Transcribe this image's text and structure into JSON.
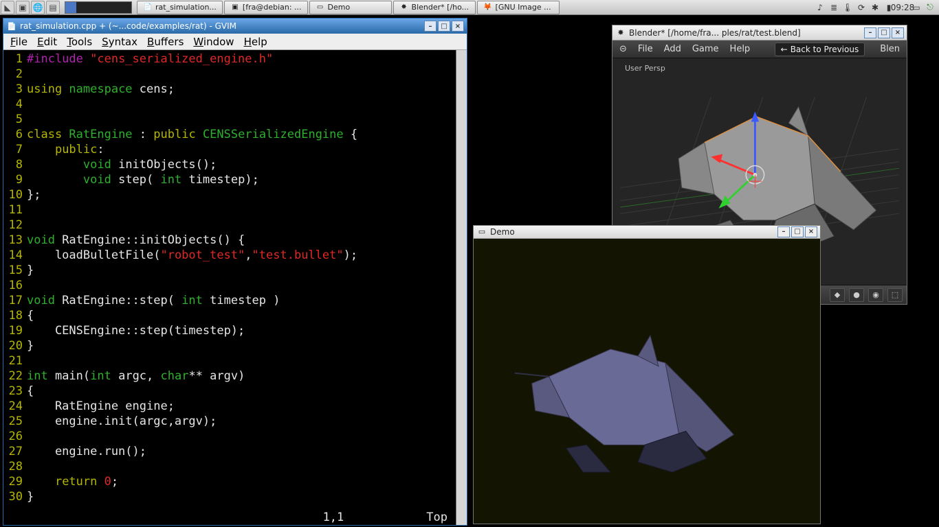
{
  "taskbar": {
    "items": [
      {
        "label": "rat_simulation...",
        "icon": "📄"
      },
      {
        "label": "[fra@debian: ...",
        "icon": "▣"
      },
      {
        "label": "Demo",
        "icon": "▭"
      },
      {
        "label": "Blender* [/ho...",
        "icon": "✸"
      },
      {
        "label": "[GNU Image ...",
        "icon": "🦊"
      }
    ],
    "clock": "09:28"
  },
  "gvim": {
    "title": "rat_simulation.cpp + (~...code/examples/rat) - GVIM",
    "menus": [
      "File",
      "Edit",
      "Tools",
      "Syntax",
      "Buffers",
      "Window",
      "Help"
    ],
    "status_pos": "1,1",
    "status_scroll": "Top",
    "code_lines": [
      [
        [
          "macro",
          "#include "
        ],
        [
          "str",
          "\"cens_serialized_engine.h\""
        ]
      ],
      [],
      [
        [
          "kw",
          "using "
        ],
        [
          "type",
          "namespace"
        ],
        [
          "plain",
          " cens;"
        ]
      ],
      [],
      [],
      [
        [
          "kw",
          "class "
        ],
        [
          "type",
          "RatEngine"
        ],
        [
          "plain",
          " : "
        ],
        [
          "kw",
          "public"
        ],
        [
          "plain",
          " "
        ],
        [
          "type",
          "CENSSerializedEngine"
        ],
        [
          "plain",
          " {"
        ]
      ],
      [
        [
          "plain",
          "    "
        ],
        [
          "kw",
          "public"
        ],
        [
          "plain",
          ":"
        ]
      ],
      [
        [
          "plain",
          "        "
        ],
        [
          "type",
          "void"
        ],
        [
          "plain",
          " initObjects();"
        ]
      ],
      [
        [
          "plain",
          "        "
        ],
        [
          "type",
          "void"
        ],
        [
          "plain",
          " step( "
        ],
        [
          "type",
          "int"
        ],
        [
          "plain",
          " timestep);"
        ]
      ],
      [
        [
          "plain",
          "};"
        ]
      ],
      [],
      [],
      [
        [
          "type",
          "void"
        ],
        [
          "plain",
          " RatEngine::initObjects() {"
        ]
      ],
      [
        [
          "plain",
          "    loadBulletFile("
        ],
        [
          "str",
          "\"robot_test\""
        ],
        [
          "plain",
          ","
        ],
        [
          "str",
          "\"test.bullet\""
        ],
        [
          "plain",
          ");"
        ]
      ],
      [
        [
          "plain",
          "}"
        ]
      ],
      [],
      [
        [
          "type",
          "void"
        ],
        [
          "plain",
          " RatEngine::step( "
        ],
        [
          "type",
          "int"
        ],
        [
          "plain",
          " timestep ) "
        ]
      ],
      [
        [
          "plain",
          "{"
        ]
      ],
      [
        [
          "plain",
          "    CENSEngine::step(timestep);"
        ]
      ],
      [
        [
          "plain",
          "}"
        ]
      ],
      [],
      [
        [
          "type",
          "int"
        ],
        [
          "plain",
          " main("
        ],
        [
          "type",
          "int"
        ],
        [
          "plain",
          " argc, "
        ],
        [
          "type",
          "char"
        ],
        [
          "plain",
          "** argv)"
        ]
      ],
      [
        [
          "plain",
          "{"
        ]
      ],
      [
        [
          "plain",
          "    RatEngine engine;"
        ]
      ],
      [
        [
          "plain",
          "    engine.init(argc,argv);"
        ]
      ],
      [],
      [
        [
          "plain",
          "    engine.run();"
        ]
      ],
      [],
      [
        [
          "plain",
          "    "
        ],
        [
          "kw",
          "return"
        ],
        [
          "plain",
          " "
        ],
        [
          "num",
          "0"
        ],
        [
          "plain",
          ";"
        ]
      ],
      [
        [
          "plain",
          "}"
        ]
      ]
    ]
  },
  "demo": {
    "title": "Demo"
  },
  "blender": {
    "title": "Blender* [/home/fra... ples/rat/test.blend]",
    "menus": [
      "File",
      "Add",
      "Game",
      "Help"
    ],
    "back": "Back to Previous",
    "rightmenu": "Blen",
    "view_label": "User Persp"
  }
}
